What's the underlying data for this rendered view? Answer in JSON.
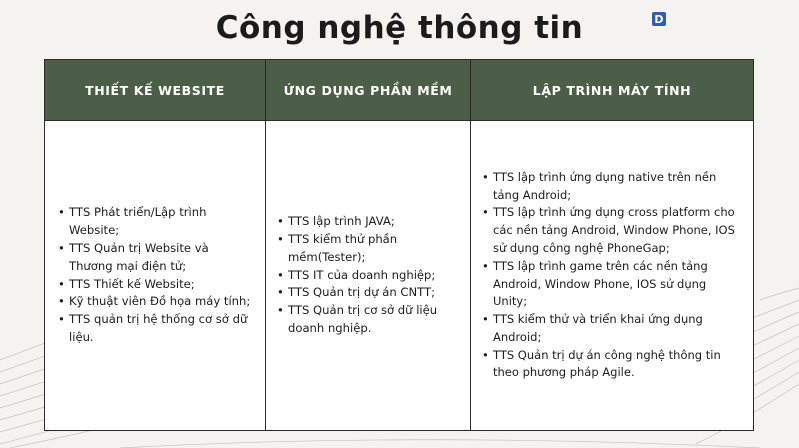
{
  "title": "Công nghệ thông tin",
  "badge": "D",
  "columns": [
    {
      "header": "THIẾT KẾ WEBSITE",
      "items": [
        "TTS Phát triển/Lập trình Website;",
        "TTS Quản trị Website và Thương mại điện tử;",
        "TTS Thiết kế Website;",
        "Kỹ thuật viên Đồ họa máy tính;",
        "TTS quản trị hệ thống cơ sở dữ liệu."
      ]
    },
    {
      "header": "ỨNG DỤNG PHẦN MỀM",
      "items": [
        "TTS lập trình JAVA;",
        "TTS kiểm thử phần mềm(Tester);",
        "TTS IT của doanh nghiệp;",
        "TTS Quản trị dự án CNTT;",
        "TTS Quản trị cơ sở dữ liệu doanh nghiệp."
      ]
    },
    {
      "header": "LẬP TRÌNH MÁY TÍNH",
      "items": [
        "TTS lập trình ứng dụng native trên nền tảng Android;",
        "TTS lập trình ứng dụng cross platform cho các nền tảng Android, Window Phone, IOS sử dụng công nghệ PhoneGap;",
        "TTS lập trình game trên các nền tảng Android, Window Phone, IOS sử dụng Unity;",
        "TTS kiểm thử và triển khai ứng dụng Android;",
        "TTS Quản trị dự án công nghệ thông tin theo phương pháp Agile."
      ]
    }
  ]
}
